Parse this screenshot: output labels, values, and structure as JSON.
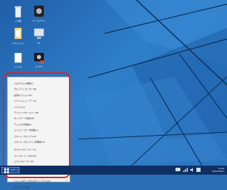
{
  "desktop": {
    "icons": [
      {
        "name": "recycle-bin-icon",
        "label": "ごみ箱"
      },
      {
        "name": "game-app-icon",
        "label": "ゲームアプリ"
      },
      {
        "name": "document-folder-icon",
        "label": "ドキュメント"
      },
      {
        "name": "computer-icon",
        "label": "PC"
      },
      {
        "name": "file-icon",
        "label": "ファイル"
      },
      {
        "name": "user-icon",
        "label": "ユーザー"
      }
    ]
  },
  "context_menu": {
    "items": [
      {
        "label": "プログラムと機能(F)"
      },
      {
        "label": "モビリティ センター(B)"
      },
      {
        "label": "電源オプション(O)"
      },
      {
        "label": "イベント ビューアー(V)"
      },
      {
        "label": "システム(Y)"
      },
      {
        "label": "デバイス マネージャー(M)"
      },
      {
        "label": "ネットワーク接続(W)"
      },
      {
        "label": "ディスクの管理(K)"
      },
      {
        "label": "コンピューターの管理(G)"
      },
      {
        "label": "コマンド プロンプト(C)"
      },
      {
        "label": "コマンド プロンプト (管理者)(A)"
      },
      {
        "label": "タスク マネージャー(T)"
      },
      {
        "label": "コントロール パネル(P)"
      },
      {
        "label": "エクスプローラー(E)"
      },
      {
        "label": "検索(S)"
      },
      {
        "label": "ファイル名を指定して実行(R)"
      },
      {
        "label": "シャットダウンまたはサインアウト(U)",
        "submenu": "›"
      },
      {
        "label": "デスクトップ(D)"
      }
    ]
  },
  "taskbar": {
    "start_label": "スタート",
    "clock_time": "12:00",
    "clock_date": "2014/10/01"
  },
  "colors": {
    "wallpaper": "#2a73be",
    "taskbar": "#0e2f63",
    "highlight_ring": "#e2231a",
    "menu_bg": "#f4f4f4"
  }
}
